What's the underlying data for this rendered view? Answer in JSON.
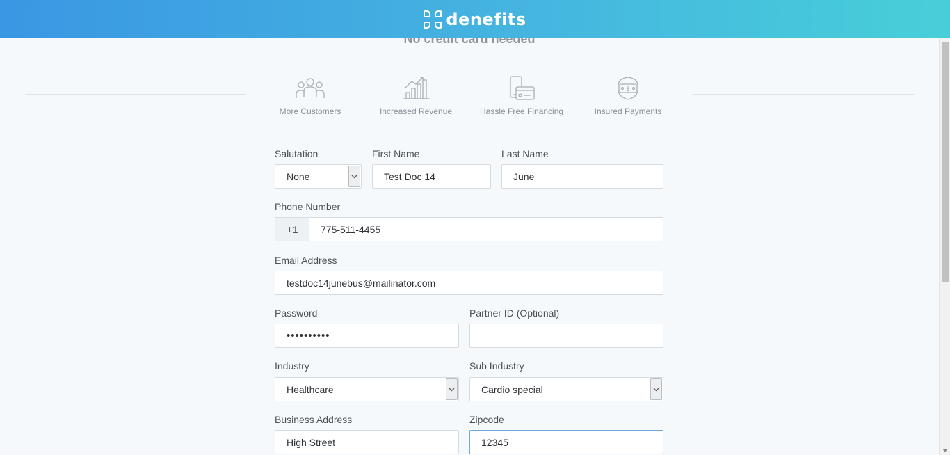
{
  "header": {
    "brand": "denefits"
  },
  "tagline": "No credit card needed",
  "features": [
    {
      "label": "More Customers",
      "icon": "customers-icon"
    },
    {
      "label": "Increased Revenue",
      "icon": "revenue-chart-icon"
    },
    {
      "label": "Hassle Free Financing",
      "icon": "financing-card-icon"
    },
    {
      "label": "Insured Payments",
      "icon": "insured-payments-icon"
    }
  ],
  "form": {
    "salutation": {
      "label": "Salutation",
      "value": "None"
    },
    "first_name": {
      "label": "First Name",
      "value": "Test Doc 14"
    },
    "last_name": {
      "label": "Last Name",
      "value": "June"
    },
    "phone": {
      "label": "Phone Number",
      "prefix": "+1",
      "value": "775-511-4455"
    },
    "email": {
      "label": "Email Address",
      "value": "testdoc14junebus@mailinator.com"
    },
    "password": {
      "label": "Password",
      "value": "••••••••••"
    },
    "partner_id": {
      "label": "Partner ID (Optional)",
      "value": ""
    },
    "industry": {
      "label": "Industry",
      "value": "Healthcare"
    },
    "sub_industry": {
      "label": "Sub Industry",
      "value": "Cardio special"
    },
    "business_address": {
      "label": "Business Address",
      "value": "High Street"
    },
    "zipcode": {
      "label": "Zipcode",
      "value": "12345"
    }
  },
  "colors": {
    "header_start": "#3a97e3",
    "header_end": "#47cfd9",
    "focus_border": "#6fa8dc"
  }
}
